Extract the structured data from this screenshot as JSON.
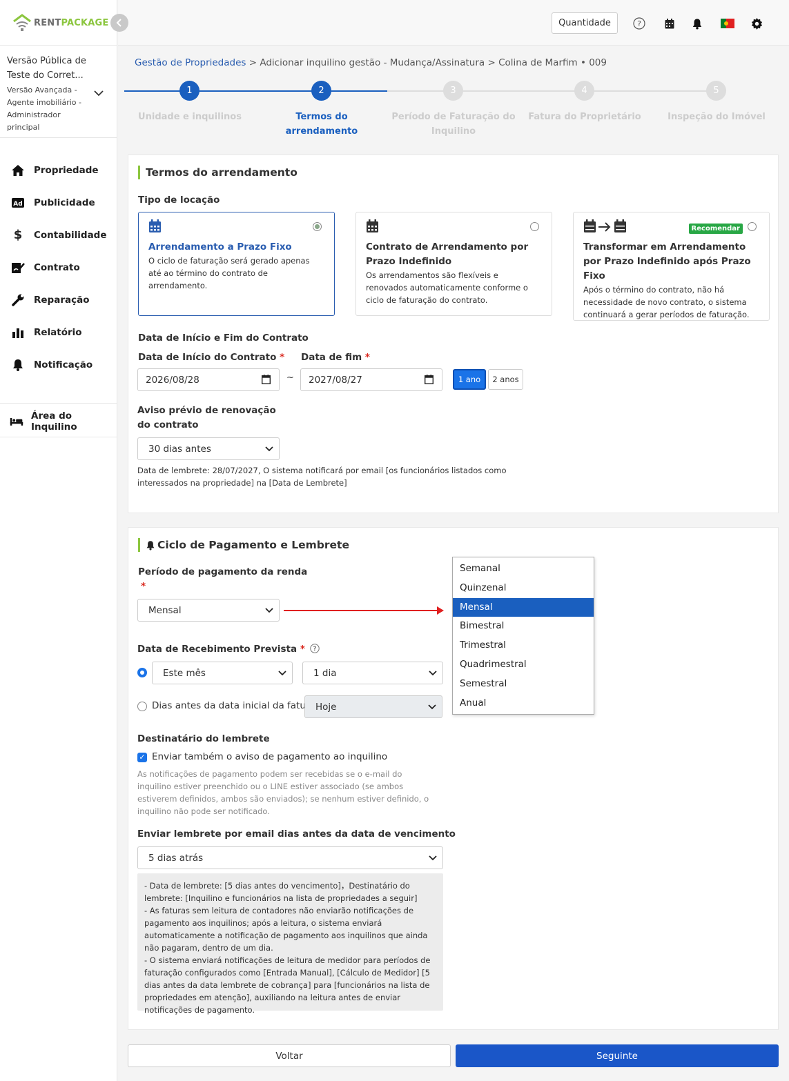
{
  "brand": {
    "part1": "RENT",
    "part2": "PACKAGE",
    "color_primary": "#8cc63f"
  },
  "user": {
    "name": "Versão Pública de Teste do Corret...",
    "role": "Versão Avançada - Agente imobiliário - Administrador principal"
  },
  "nav": {
    "items": [
      {
        "label": "Propriedade",
        "icon": "home-icon"
      },
      {
        "label": "Publicidade",
        "icon": "ad-icon"
      },
      {
        "label": "Contabilidade",
        "icon": "dollar-icon"
      },
      {
        "label": "Contrato",
        "icon": "contract-icon"
      },
      {
        "label": "Reparação",
        "icon": "wrench-icon"
      },
      {
        "label": "Relatório",
        "icon": "chart-icon"
      },
      {
        "label": "Notificação",
        "icon": "bell-icon"
      }
    ],
    "tenant_area": "Área do Inquilino"
  },
  "topbar": {
    "quantity_label": "Quantidade"
  },
  "breadcrumb": {
    "root": "Gestão de Propriedades",
    "sep": ">",
    "middle": "Adicionar inquilino gestão - Mudança/Assinatura",
    "current": "Colina de Marfim • 009"
  },
  "stepper": {
    "steps": [
      {
        "number": "1",
        "label": "Unidade e inquilinos"
      },
      {
        "number": "2",
        "label": "Termos do arrendamento"
      },
      {
        "number": "3",
        "label": "Período de Faturação do Inquilino"
      },
      {
        "number": "4",
        "label": "Fatura do Proprietário"
      },
      {
        "number": "5",
        "label": "Inspeção do Imóvel"
      }
    ],
    "active_step": 2,
    "active_color": "#1a5fbf"
  },
  "lease": {
    "title": "Termos do arrendamento",
    "type_label": "Tipo de locação",
    "options": [
      {
        "title": "Arrendamento a Prazo Fixo",
        "desc": "O ciclo de faturação será gerado apenas até ao término do contrato de arrendamento."
      },
      {
        "title": "Contrato de Arrendamento por Prazo Indefinido",
        "desc": "Os arrendamentos são flexíveis e renovados automaticamente conforme o ciclo de faturação do contrato."
      },
      {
        "title": "Transformar em Arrendamento por Prazo Indefinido após Prazo Fixo",
        "desc": "Após o término do contrato, não há necessidade de novo contrato, o sistema continuará a gerar períodos de faturação.",
        "badge": "Recomendar"
      }
    ],
    "dates_label": "Data de Início e Fim do Contrato",
    "start_label": "Data de Início do Contrato",
    "end_label": "Data de fim",
    "required_mark": "*",
    "start_value": "2026/08/28",
    "tilde": "~",
    "end_value": "2027/08/27",
    "duration_1": "1 ano",
    "duration_2": "2 anos",
    "notice_label": "Aviso prévio de renovação do contrato",
    "notice_value": "30 dias antes",
    "reminder_note": "Data de lembrete: 28/07/2027, O sistema notificará por email [os funcionários listados como interessados na propriedade] na [Data de Lembrete]"
  },
  "payment": {
    "title": "Ciclo de Pagamento e Lembrete",
    "period_label": "Período de pagamento da renda",
    "period_value": "Mensal",
    "period_options": [
      "Semanal",
      "Quinzenal",
      "Mensal",
      "Bimestral",
      "Trimestral",
      "Quadrimestral",
      "Semestral",
      "Anual"
    ],
    "selected_option": "Mensal",
    "expected_label": "Data de Recebimento Prevista",
    "month_value": "Este mês",
    "day_value": "1 dia",
    "days_before_label": "Dias antes da data inicial da fatura:",
    "days_before_value": "Hoje",
    "recipient_label": "Destinatário do lembrete",
    "send_tenant_label": "Enviar também o aviso de pagamento ao inquilino",
    "send_tenant_hint": "As notificações de pagamento podem ser recebidas se o e-mail do inquilino estiver preenchido ou o LINE estiver associado (se ambos estiverem definidos, ambos são enviados); se nenhum estiver definido, o inquilino não pode ser notificado.",
    "email_reminder_label": "Enviar lembrete por email dias antes da data de vencimento",
    "email_reminder_value": "5 dias atrás",
    "info_lines": [
      "- Data de lembrete: [5 dias antes do vencimento]，Destinatário do lembrete: [Inquilino e funcionários na lista de propriedades a seguir]",
      "- As faturas sem leitura de contadores não enviarão notificações de pagamento aos inquilinos; após a leitura, o sistema enviará automaticamente a notificação de pagamento aos inquilinos que ainda não pagaram, dentro de um dia.",
      "- O sistema enviará notificações de leitura de medidor para períodos de faturação configurados como [Entrada Manual], [Cálculo de Medidor] [5 dias antes da data lembrete de cobrança] para [funcionários na lista de propriedades em atenção], auxiliando na leitura antes de enviar notificações de pagamento."
    ]
  },
  "footer": {
    "back": "Voltar",
    "next": "Seguinte"
  }
}
